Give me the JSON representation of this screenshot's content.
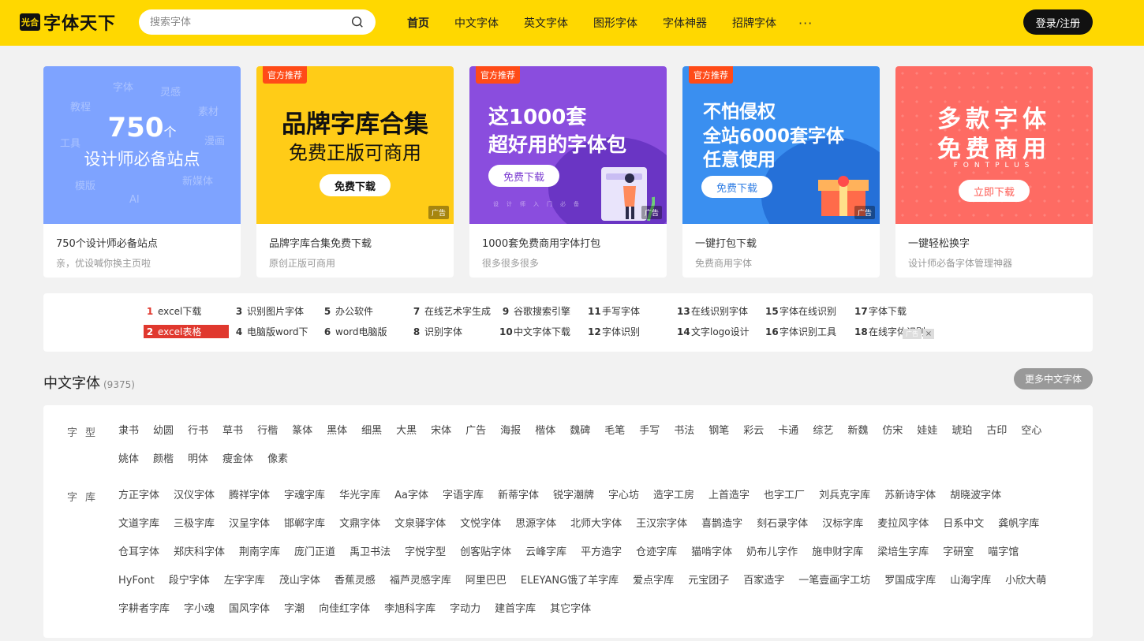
{
  "header": {
    "logo_badge": "光合",
    "logo_text": "字体天下",
    "search_placeholder": "搜索字体",
    "nav": [
      "首页",
      "中文字体",
      "英文字体",
      "图形字体",
      "字体神器",
      "招牌字体"
    ],
    "more": "···",
    "login": "登录/注册"
  },
  "banners": [
    {
      "title": "750个设计师必备站点",
      "sub": "亲，优设喊你换主页啦",
      "num": "750",
      "unit": "个",
      "line": "设计师必备站点",
      "words": [
        "字体",
        "灵感",
        "教程",
        "素材",
        "工具",
        "漫画",
        "模版",
        "新媒体",
        "AI"
      ]
    },
    {
      "tag": "官方推荐",
      "t1": "品牌字库合集",
      "t2": "免费正版可商用",
      "btn": "免费下载",
      "ad": "广告",
      "title": "品牌字库合集免费下载",
      "sub": "原创正版可商用"
    },
    {
      "tag": "官方推荐",
      "t1": "这1000套",
      "t2": "超好用的字体包",
      "btn": "免费下载",
      "ad": "广告",
      "tiny": "设计师入门必备",
      "title": "1000套免费商用字体打包",
      "sub": "很多很多很多"
    },
    {
      "tag": "官方推荐",
      "t1": "不怕侵权",
      "t2": "全站6000套字体",
      "t3": "任意使用",
      "btn": "免费下载",
      "ad": "广告",
      "title": "一键打包下载",
      "sub": "免费商用字体"
    },
    {
      "t1": "多款字体",
      "t2": "免费商用",
      "t3": "FONTPLUS",
      "btn": "立即下载",
      "title": "一键轻松换字",
      "sub": "设计师必备字体管理神器"
    }
  ],
  "hot": [
    {
      "n": "1",
      "t": "excel下载"
    },
    {
      "n": "2",
      "t": "excel表格"
    },
    {
      "n": "3",
      "t": "识别图片字体"
    },
    {
      "n": "4",
      "t": "电脑版word下"
    },
    {
      "n": "5",
      "t": "办公软件"
    },
    {
      "n": "6",
      "t": "word电脑版"
    },
    {
      "n": "7",
      "t": "在线艺术字生成"
    },
    {
      "n": "8",
      "t": "识别字体"
    },
    {
      "n": "9",
      "t": "谷歌搜索引擎"
    },
    {
      "n": "10",
      "t": "中文字体下载"
    },
    {
      "n": "11",
      "t": "手写字体"
    },
    {
      "n": "12",
      "t": "字体识别"
    },
    {
      "n": "13",
      "t": "在线识别字体"
    },
    {
      "n": "14",
      "t": "文字logo设计"
    },
    {
      "n": "15",
      "t": "字体在线识别"
    },
    {
      "n": "16",
      "t": "字体识别工具"
    },
    {
      "n": "17",
      "t": "字体下载"
    },
    {
      "n": "18",
      "t": "在线字体识别"
    }
  ],
  "hot_ad": "广告",
  "hot_close": "×",
  "section": {
    "title": "中文字体",
    "count": "(9375)",
    "more": "更多中文字体"
  },
  "categories": [
    {
      "label": "字型",
      "items": [
        "隶书",
        "幼圆",
        "行书",
        "草书",
        "行楷",
        "篆体",
        "黑体",
        "细黑",
        "大黑",
        "宋体",
        "广告",
        "海报",
        "楷体",
        "魏碑",
        "毛笔",
        "手写",
        "书法",
        "钢笔",
        "彩云",
        "卡通",
        "综艺",
        "新魏",
        "仿宋",
        "娃娃",
        "琥珀",
        "古印",
        "空心",
        "姚体",
        "颜楷",
        "明体",
        "瘦金体",
        "像素"
      ]
    },
    {
      "label": "字库",
      "items": [
        "方正字体",
        "汉仪字体",
        "腾祥字体",
        "字魂字库",
        "华光字库",
        "Aa字体",
        "字语字库",
        "新蒂字体",
        "锐字潮牌",
        "字心坊",
        "造字工房",
        "上首造字",
        "也字工厂",
        "刘兵克字库",
        "苏新诗字体",
        "胡晓波字体",
        "文道字库",
        "三极字库",
        "汉呈字体",
        "邯郸字库",
        "文鼎字体",
        "文泉驿字体",
        "文悦字体",
        "思源字体",
        "北师大字体",
        "王汉宗字体",
        "喜鹊造字",
        "刻石录字体",
        "汉标字库",
        "麦拉风字体",
        "日系中文",
        "龚帆字库",
        "仓耳字体",
        "郑庆科字体",
        "荆南字库",
        "庞门正道",
        "禹卫书法",
        "字悦字型",
        "创客贴字体",
        "云峰字库",
        "平方造字",
        "仓迹字库",
        "猫啃字体",
        "奶布儿字作",
        "施申财字库",
        "梁培生字库",
        "字研室",
        "喵字馆",
        "HyFont",
        "段宁字体",
        "左字字库",
        "茂山字体",
        "香蕉灵感",
        "福芦灵感字库",
        "阿里巴巴",
        "ELEYANG饿了羊字库",
        "爱点字库",
        "元宝团子",
        "百家造字",
        "一笔壹画字工坊",
        "罗国成字库",
        "山海字库",
        "小欣大萌",
        "字耕者字库",
        "字小魂",
        "国风字体",
        "字潮",
        "向佳红字体",
        "李旭科字库",
        "字动力",
        "建首字库",
        "其它字体"
      ]
    }
  ]
}
